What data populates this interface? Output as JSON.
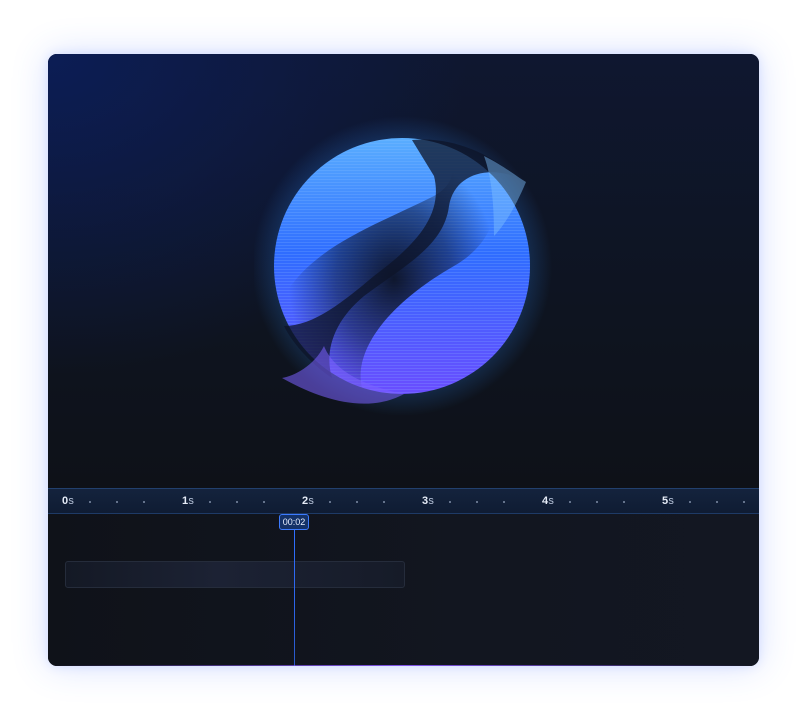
{
  "timeline": {
    "ticks": [
      {
        "value": "0",
        "unit": "s"
      },
      {
        "value": "1",
        "unit": "s"
      },
      {
        "value": "2",
        "unit": "s"
      },
      {
        "value": "3",
        "unit": "s"
      },
      {
        "value": "4",
        "unit": "s"
      },
      {
        "value": "5",
        "unit": "s"
      }
    ],
    "playhead_time": "00:02",
    "playhead_seconds": 2
  },
  "colors": {
    "accent": "#3c7bff",
    "orb_light": "#56a8ff",
    "orb_mid": "#2f6dff",
    "orb_violet": "#6a4dff",
    "ruler_bg": "#14233d",
    "panel_bg": "#0e1118"
  }
}
